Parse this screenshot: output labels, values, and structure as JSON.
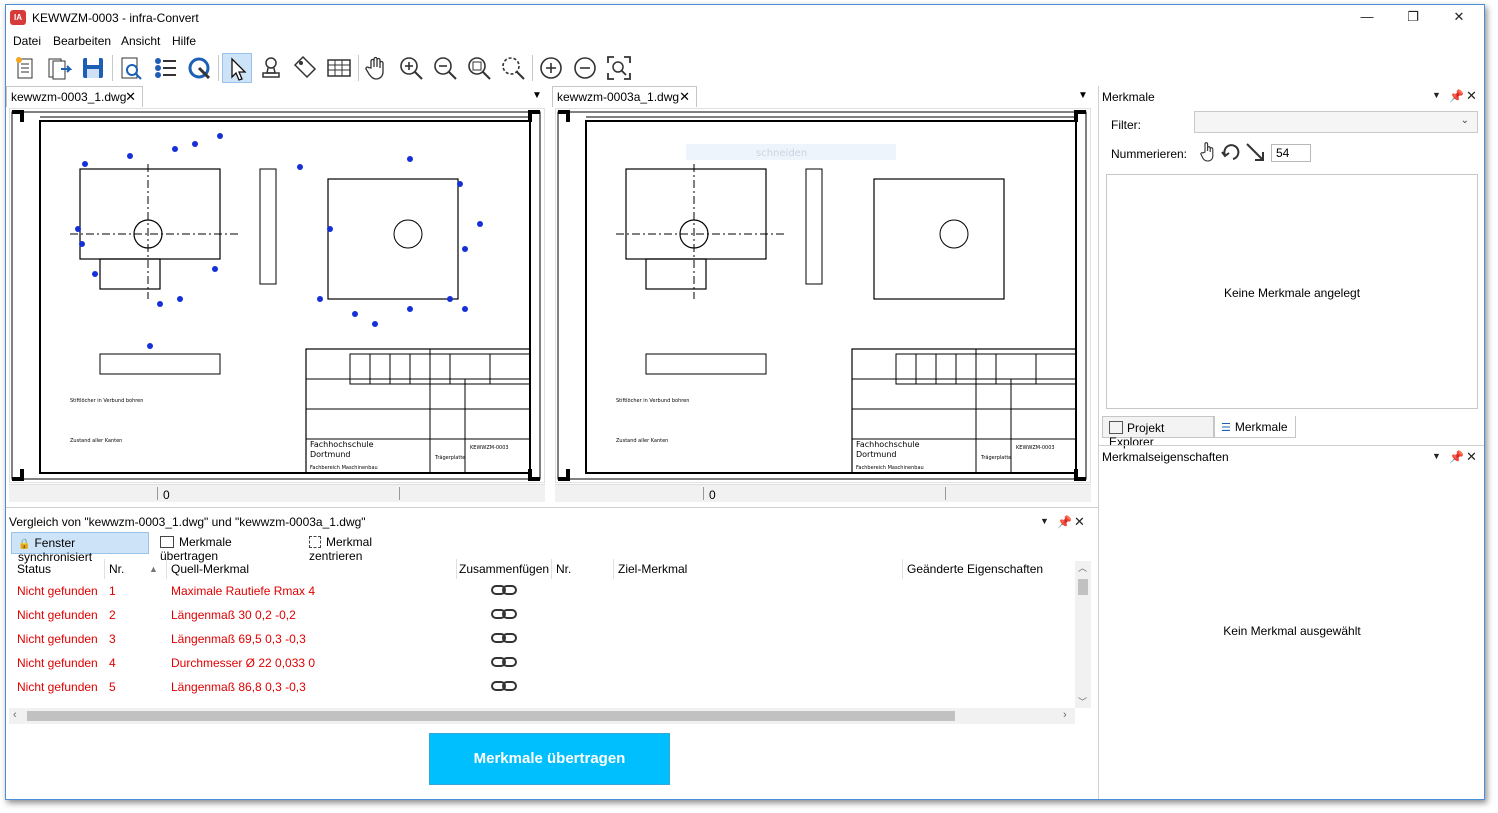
{
  "window": {
    "title": "KEWWZM-0003 - infra-Convert",
    "icon_text": "IA"
  },
  "menu": [
    "Datei",
    "Bearbeiten",
    "Ansicht",
    "Hilfe"
  ],
  "toolbar_icons": [
    "new-doc-icon",
    "import-icon",
    "save-icon",
    "search-doc-icon",
    "list-icon",
    "settings-wrench-icon",
    "pointer-icon",
    "stamp-icon",
    "tag-icon",
    "table-icon",
    "hand-icon",
    "zoom-in-icon",
    "zoom-out-icon",
    "zoom-fit-icon",
    "zoom-area-icon",
    "plus-circle-icon",
    "minus-circle-icon",
    "fit-window-icon"
  ],
  "documents": [
    {
      "tab": "kewwzm-0003_1.dwg",
      "scroll_value": "0"
    },
    {
      "tab": "kewwzm-0003a_1.dwg",
      "scroll_value": "0"
    }
  ],
  "merkmale_panel": {
    "title": "Merkmale",
    "filter_label": "Filter:",
    "filter_value": "",
    "numerieren_label": "Nummerieren:",
    "number_value": "54",
    "empty_text": "Keine Merkmale angelegt"
  },
  "bottom_tabs": [
    "Projekt Explorer",
    "Merkmale"
  ],
  "properties_panel": {
    "title": "Merkmalseigenschaften",
    "empty_text": "Kein Merkmal ausgewählt"
  },
  "compare_panel": {
    "title": "Vergleich von \"kewwzm-0003_1.dwg\" und \"kewwzm-0003a_1.dwg\"",
    "buttons": [
      "Fenster synchronisiert",
      "Merkmale übertragen",
      "Merkmal zentrieren"
    ],
    "columns": [
      "Status",
      "Nr.",
      "Quell-Merkmal",
      "Zusammenfügen",
      "Nr.",
      "Ziel-Merkmal",
      "Geänderte Eigenschaften"
    ],
    "rows": [
      {
        "status": "Nicht gefunden",
        "nr": "1",
        "quell": "Maximale Rautiefe Rmax 4"
      },
      {
        "status": "Nicht gefunden",
        "nr": "2",
        "quell": "Längenmaß  30 0,2 -0,2"
      },
      {
        "status": "Nicht gefunden",
        "nr": "3",
        "quell": "Längenmaß  69,5 0,3 -0,3"
      },
      {
        "status": "Nicht gefunden",
        "nr": "4",
        "quell": "Durchmesser Ø 22 0,033 0"
      },
      {
        "status": "Nicht gefunden",
        "nr": "5",
        "quell": "Längenmaß  86,8 0,3 -0,3"
      }
    ],
    "transfer_button": "Merkmale übertragen"
  },
  "drawing_text": {
    "school": "Fachhochschule",
    "city": "Dortmund",
    "dept": "Fachbereich Maschinenbau",
    "part": "Trägerplatte",
    "code": "KEWWZM-0003",
    "note1": "Zustand aller Kanten",
    "note2": "Stiftlöcher in Verbund bohren",
    "ghost_text": "schneiden"
  },
  "colors": {
    "status_red": "#e00000",
    "accent_blue": "#00bfff",
    "marker_blue": "#1530d8"
  }
}
